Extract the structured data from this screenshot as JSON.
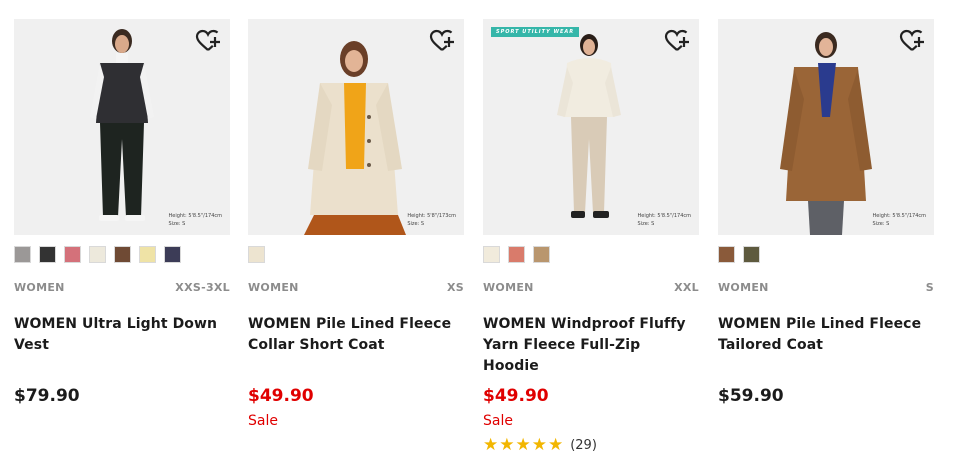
{
  "products": [
    {
      "gender": "WOMEN",
      "sizes": "XXS-3XL",
      "name": "WOMEN Ultra Light Down Vest",
      "price": "$79.90",
      "on_sale": false,
      "model_info": [
        "Height: 5'8.5\"/174cm",
        "Size: S"
      ],
      "swatches": [
        "#9b9897",
        "#333333",
        "#d4717a",
        "#ede9dc",
        "#6f4a34",
        "#efe3a6",
        "#3c3c57"
      ]
    },
    {
      "gender": "WOMEN",
      "sizes": "XS",
      "name": "WOMEN Pile Lined Fleece Collar Short Coat",
      "price": "$49.90",
      "on_sale": true,
      "sale_label": "Sale",
      "model_info": [
        "Height: 5'8\"/173cm",
        "Size: S"
      ],
      "swatches": [
        "#ede4d0"
      ]
    },
    {
      "tag": "SPORT UTILITY WEAR",
      "gender": "WOMEN",
      "sizes": "XXL",
      "name": "WOMEN Windproof Fluffy Yarn Fleece Full-Zip Hoodie",
      "price": "$49.90",
      "on_sale": true,
      "sale_label": "Sale",
      "rating": 4.5,
      "stars": "★★★★★",
      "review_count": "(29)",
      "model_info": [
        "Height: 5'8.5\"/174cm",
        "Size: S"
      ],
      "swatches": [
        "#f1ebdc",
        "#d97b6b",
        "#b9966e"
      ]
    },
    {
      "gender": "WOMEN",
      "sizes": "S",
      "name": "WOMEN Pile Lined Fleece Tailored Coat",
      "price": "$59.90",
      "on_sale": false,
      "model_info": [
        "Height: 5'8.5\"/174cm",
        "Size: S"
      ],
      "swatches": [
        "#8a5a3a",
        "#5e5a3e"
      ]
    }
  ],
  "icons": {
    "wishlist": "heart-plus-icon",
    "rating": "star-icon"
  },
  "colors": {
    "sale": "#e00000",
    "star": "#f2b600",
    "tag": "#35b6a9"
  }
}
